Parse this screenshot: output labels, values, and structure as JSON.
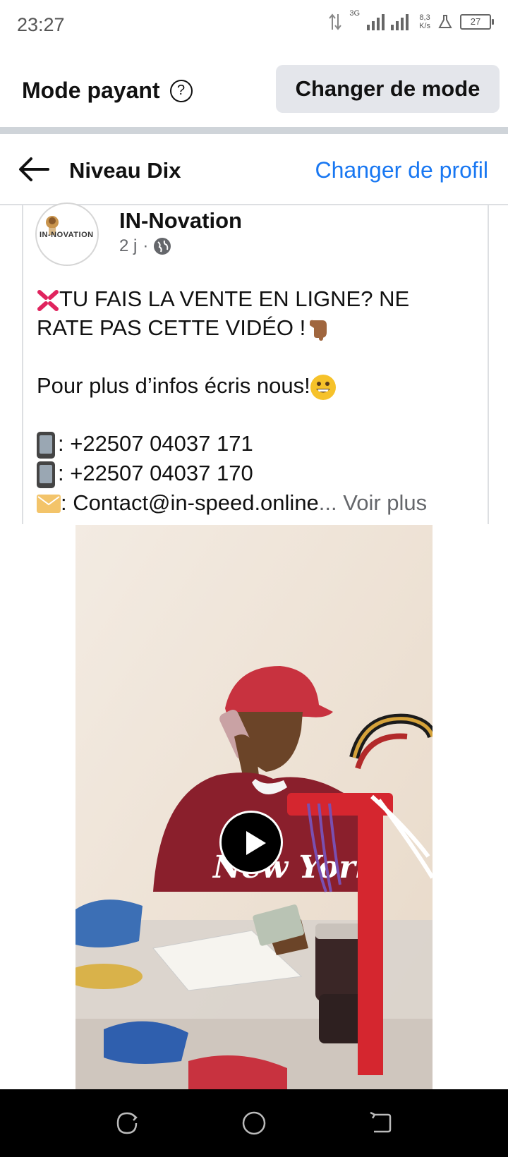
{
  "status_bar": {
    "time": "23:27",
    "network": "3G",
    "speed_value": "8,3",
    "speed_unit": "K/s",
    "battery": "27"
  },
  "mode_bar": {
    "title": "Mode payant",
    "help_icon": "question-circle-icon",
    "change_mode_label": "Changer de mode"
  },
  "profile_bar": {
    "back_icon": "arrow-left-icon",
    "name": "Niveau Dix",
    "change_profile_label": "Changer de profil"
  },
  "post": {
    "avatar_text": "IN-NOVATION",
    "author": "IN-Novation",
    "time": "2 j",
    "separator": "·",
    "privacy_icon": "globe-icon",
    "text": {
      "line1": "TU FAIS LA VENTE EN LIGNE? NE",
      "line2": "RATE PAS CETTE VIDÉO !",
      "line3": "Pour plus d’infos écris nous!",
      "line4": ": +22507 04037 171",
      "line5": ": +22507 04037 170",
      "line6": ": Contact@in-speed.online",
      "see_more": "... Voir plus"
    },
    "video": {
      "play_icon": "play-icon",
      "shirt_text": "New York"
    }
  },
  "nav_bar": {
    "recent_icon": "recent-apps-icon",
    "home_icon": "home-icon",
    "back_icon": "back-icon"
  },
  "colors": {
    "link": "#1877f2",
    "secondary_text": "#65676b",
    "button_bg": "#e4e6eb"
  }
}
